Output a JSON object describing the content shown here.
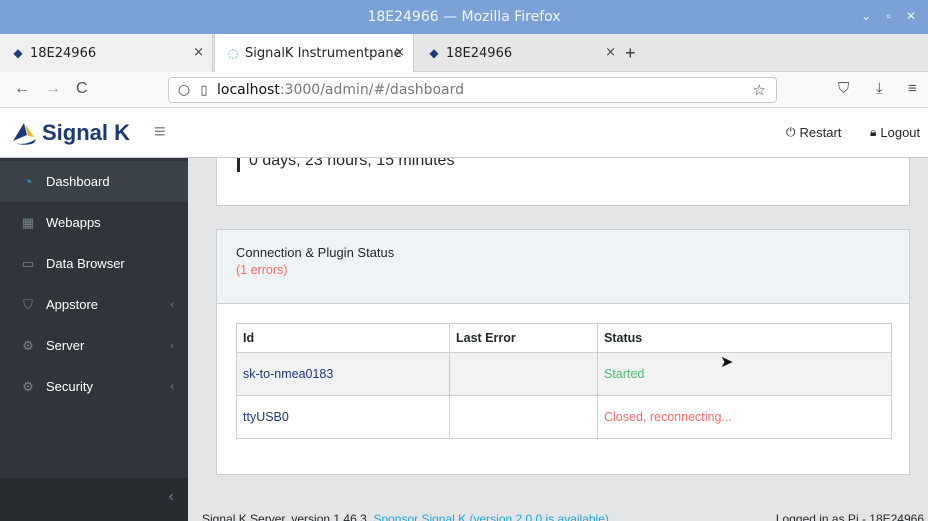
{
  "window": {
    "title": "18E24966 — Mozilla Firefox",
    "controls": "⌄ ▫ ✕"
  },
  "tabs": [
    {
      "label": "18E24966",
      "close": "×"
    },
    {
      "label": "SignalK Instrumentpane",
      "close": "×"
    },
    {
      "label": "18E24966",
      "close": "×"
    }
  ],
  "newtab": "+",
  "nav": {
    "back": "←",
    "forward": "→",
    "reload": "C",
    "url_host": "localhost",
    "url_path": ":3000/admin/#/dashboard",
    "bookmark": "☆",
    "pocket": "⛉",
    "download": "⤓",
    "menu": "≡"
  },
  "app": {
    "brand": "Signal K",
    "restart_label": "Restart",
    "logout_label": "Logout"
  },
  "sidebar": {
    "items": [
      {
        "label": "Dashboard",
        "icon": "◔",
        "active": true,
        "chevron": ""
      },
      {
        "label": "Webapps",
        "icon": "▦",
        "chevron": ""
      },
      {
        "label": "Data Browser",
        "icon": "▭",
        "chevron": ""
      },
      {
        "label": "Appstore",
        "icon": "⛉",
        "chevron": "‹"
      },
      {
        "label": "Server",
        "icon": "⚙",
        "chevron": "‹"
      },
      {
        "label": "Security",
        "icon": "⚙",
        "chevron": "‹"
      }
    ],
    "minimizer": "‹"
  },
  "uptime": "0 days, 23 hours, 15 minutes",
  "status_card": {
    "title": "Connection & Plugin Status",
    "errors": "(1 errors)",
    "columns": [
      "Id",
      "Last Error",
      "Status"
    ],
    "rows": [
      {
        "id": "sk-to-nmea0183",
        "last_error": "",
        "status": "Started",
        "state": "ok"
      },
      {
        "id": "ttyUSB0",
        "last_error": "",
        "status": "Closed, reconnecting...",
        "state": "bad"
      }
    ]
  },
  "footer": {
    "prefix": "Signal K Server, version 1.46.3.",
    "link": "Sponsor Signal K (version 2.0.0 is available)",
    "right": "Logged in as Pi - 18E24966"
  },
  "colors": {
    "brand": "#1d3a78",
    "ok": "#4dbd74",
    "error": "#f86c6b",
    "sidebar": "#2f353a"
  }
}
